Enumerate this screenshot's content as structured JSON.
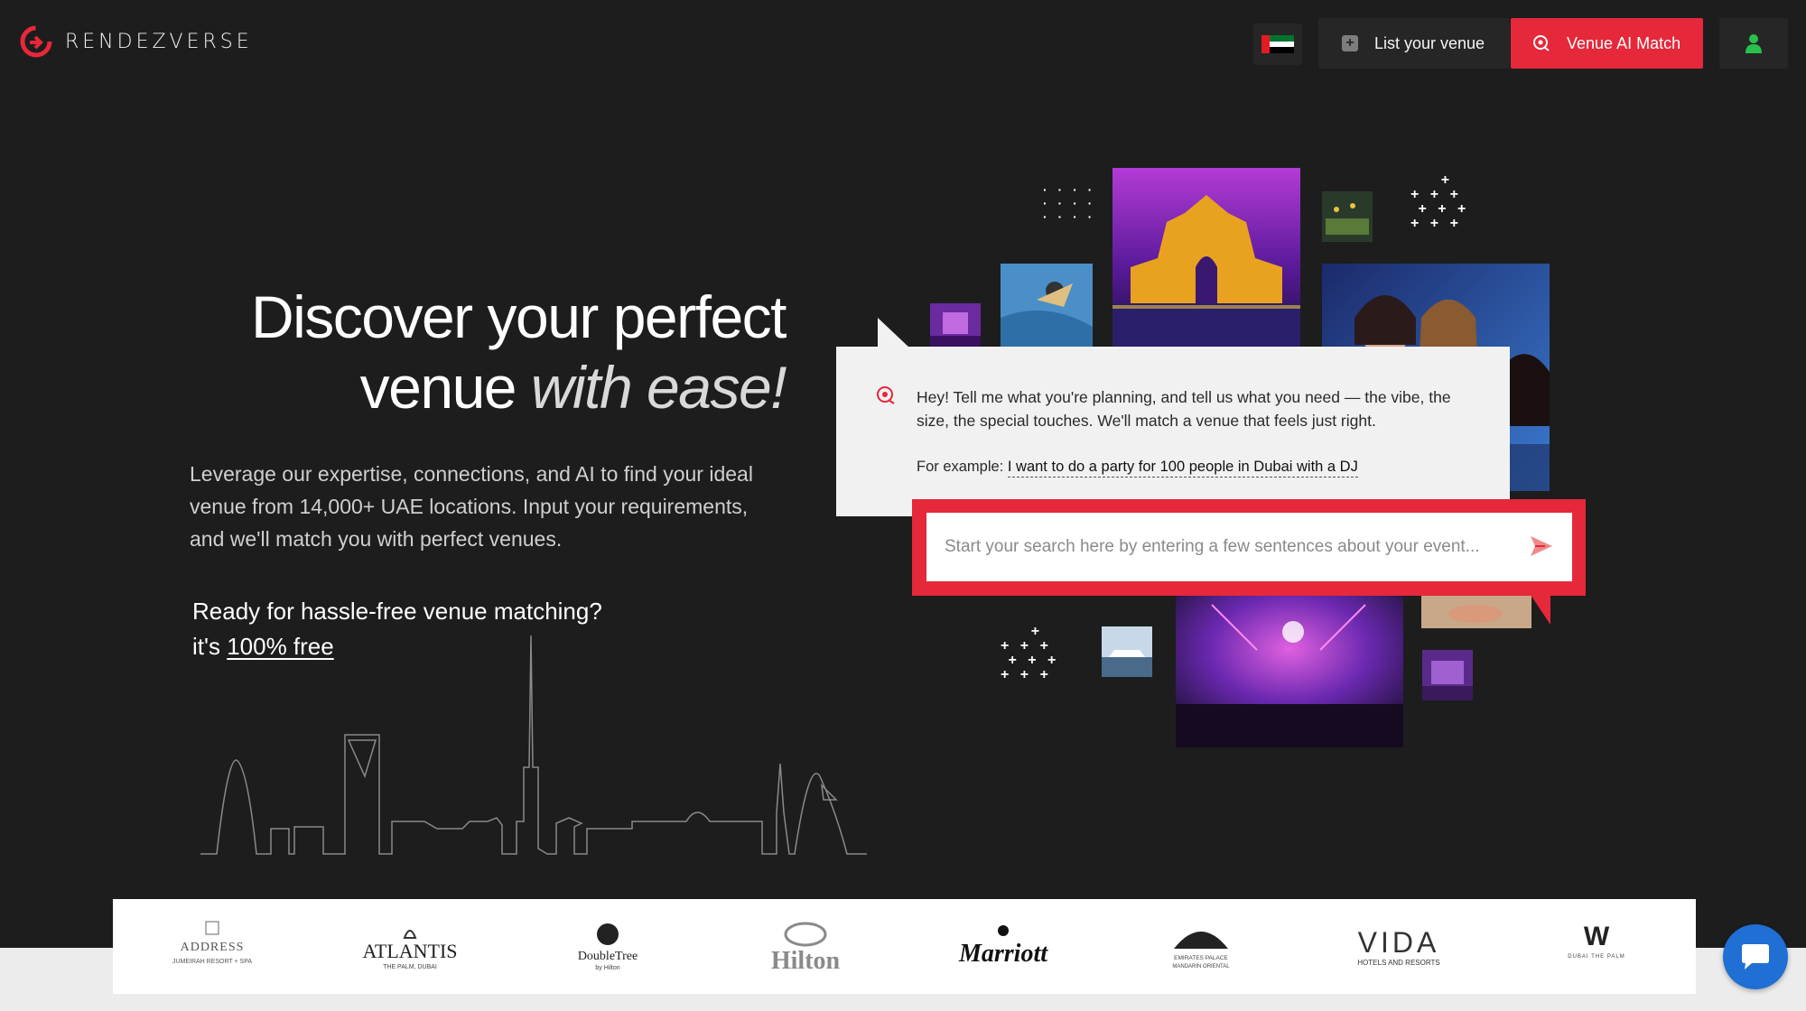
{
  "brand": {
    "name": "RENDEZVERSE",
    "accent": "#e5283a"
  },
  "header": {
    "flag_icon": "uae-flag-icon",
    "list_venue_label": "List your venue",
    "ai_match_label": "Venue AI Match",
    "user_icon": "user-icon"
  },
  "hero": {
    "title_line1": "Discover your perfect",
    "title_line2_plain": "venue ",
    "title_line2_em": "with ease!",
    "description": "Leverage our expertise, connections, and AI to find your ideal venue from 14,000+ UAE locations. Input your requirements, and we'll match you with perfect venues.",
    "cta_line1": "Ready for hassle-free venue matching?",
    "cta_prefix": "it's ",
    "cta_free": "100% free"
  },
  "chat": {
    "message": "Hey! Tell me what you're planning, and tell us what you need — the vibe, the size, the special touches. We'll match a venue that feels just right.",
    "example_label": "For example: ",
    "example_text": "I want to do a party for 100 people in Dubai with a DJ"
  },
  "search": {
    "placeholder": "Start your search here by entering a few sentences about your event...",
    "value": ""
  },
  "partners": [
    {
      "name": "ADDRESS",
      "sub": "JUMEIRAH RESORT + SPA"
    },
    {
      "name": "ATLANTIS",
      "sub": "THE PALM, DUBAI"
    },
    {
      "name": "DoubleTree",
      "sub": "by Hilton"
    },
    {
      "name": "Hilton",
      "sub": ""
    },
    {
      "name": "Marriott",
      "sub": ""
    },
    {
      "name": "EMIRATES PALACE",
      "sub": "MANDARIN ORIENTAL"
    },
    {
      "name": "VIDA",
      "sub": "HOTELS AND RESORTS"
    },
    {
      "name": "W",
      "sub": "DUBAI THE PALM"
    }
  ]
}
